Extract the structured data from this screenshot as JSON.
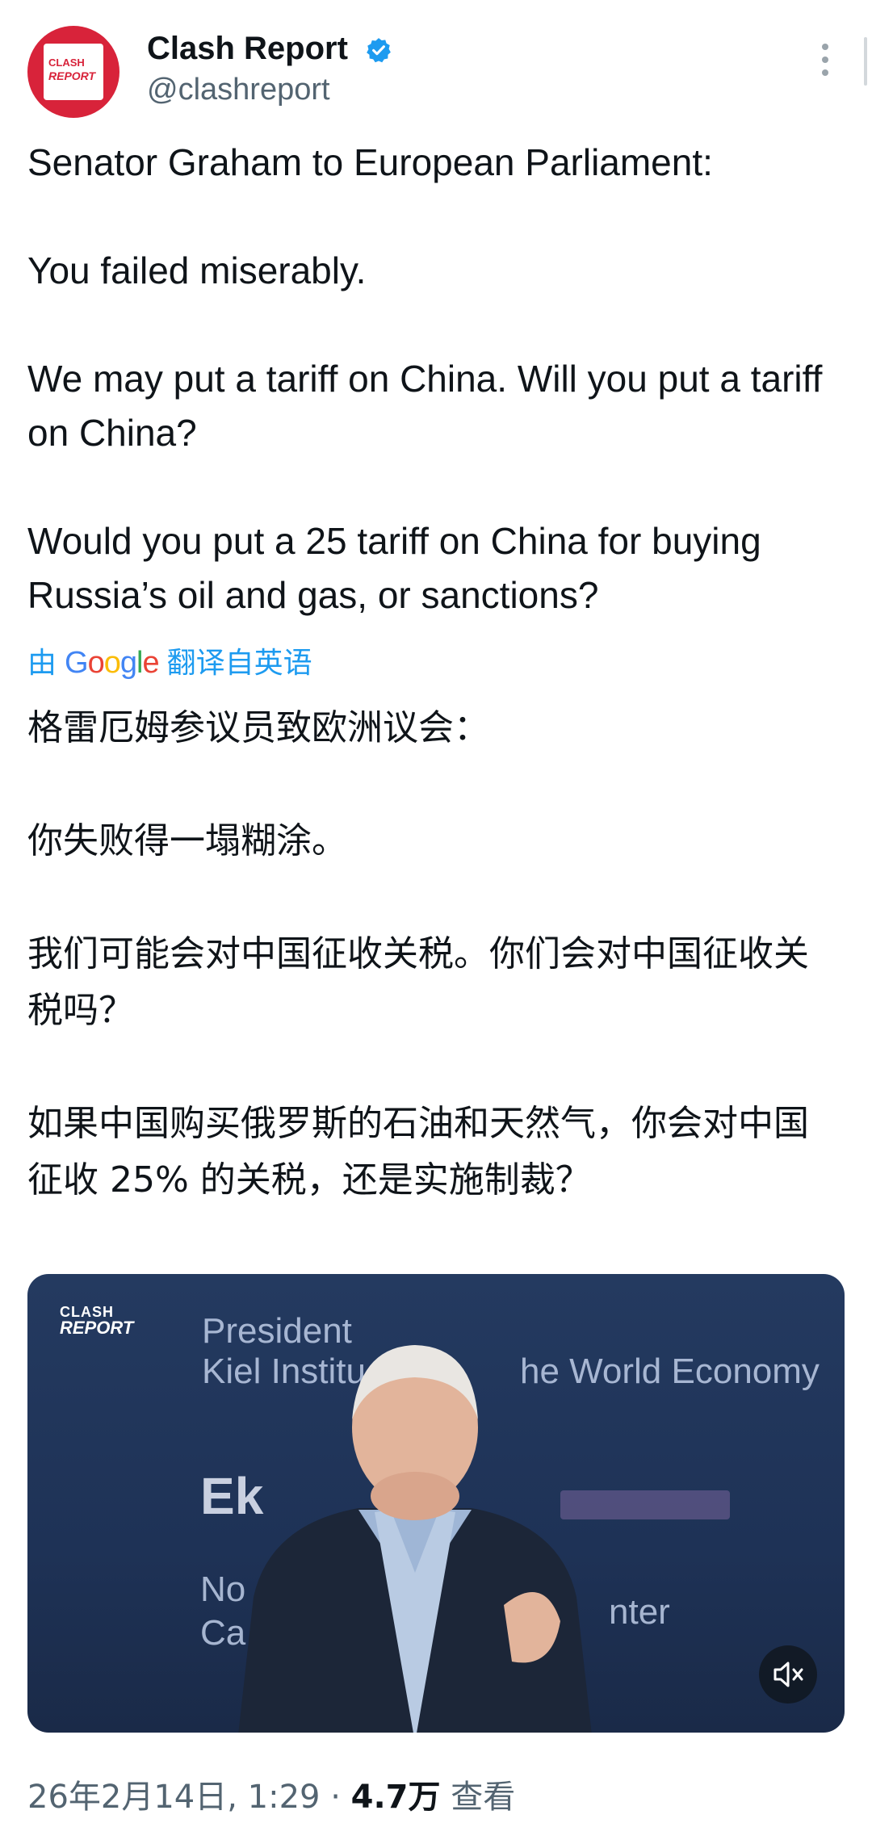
{
  "author": {
    "name": "Clash Report",
    "handle": "@clashreport",
    "avatar_line1": "CLASH",
    "avatar_line2": "REPORT"
  },
  "tweet": {
    "p1": "Senator Graham to European Parliament:",
    "p2": "You failed miserably.",
    "p3": "We may put a tariff on China. Will you put a tariff on China?",
    "p4": "Would you put a 25 tariff on China for buying Russia’s oil and gas, or sanctions?"
  },
  "translation": {
    "prefix": "由",
    "suffix": "翻译自英语",
    "cn_p1": "格雷厄姆参议员致欧洲议会：",
    "cn_p2": "你失败得一塌糊涂。",
    "cn_p3": "我们可能会对中国征收关税。你们会对中国征收关税吗？",
    "cn_p4": "如果中国购买俄罗斯的石油和天然气，你会对中国征收 25% 的关税，还是实施制裁？"
  },
  "video": {
    "logo_line1": "CLASH",
    "logo_line2": "REPORT",
    "bg_line1": "President",
    "bg_line2": "Kiel Institu",
    "bg_line3": "he World Economy",
    "bg_line4": "Ek",
    "bg_line5": "No",
    "bg_line6": "Ca",
    "bg_line7": "nter"
  },
  "meta": {
    "timestamp": "26年2月14日, 1:29 · ",
    "views": "4.7万",
    "views_label": " 查看"
  }
}
